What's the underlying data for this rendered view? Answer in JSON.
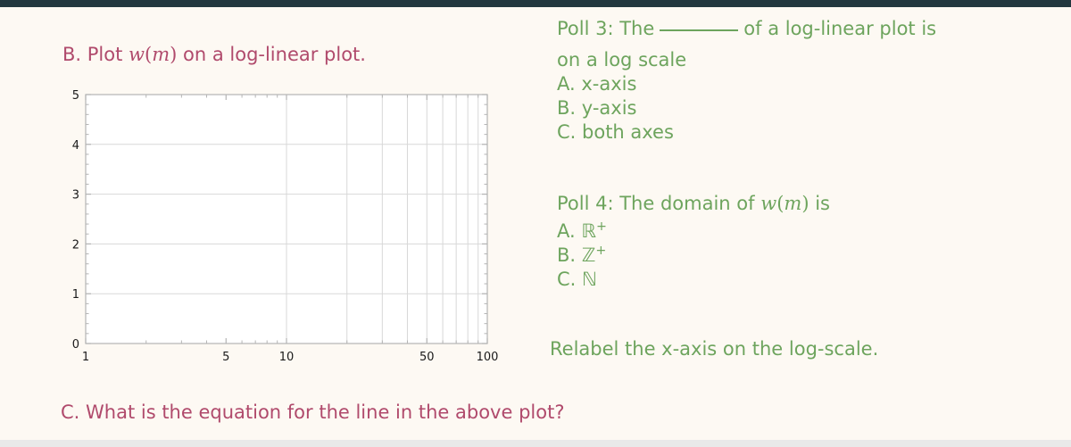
{
  "slide": {
    "background_color": "#fdf9f3",
    "top_bar_color": "#23383f",
    "bottom_bar_color": "#e9e9e9",
    "question_color": "#b04a6c",
    "poll_color": "#6da45d"
  },
  "prompts": {
    "b_prefix": "B. Plot ",
    "b_func_w": "w",
    "b_func_open": "(",
    "b_func_m": "m",
    "b_func_close": ")",
    "b_suffix": " on a log-linear plot.",
    "c_text": "C. What is the equation for the line in the above plot?"
  },
  "poll3": {
    "lead": "Poll 3:  The",
    "after_blank": "of a log-linear plot is",
    "line2": "on a log scale",
    "options": [
      "A. x-axis",
      "B. y-axis",
      "C. both axes"
    ]
  },
  "poll4": {
    "lead": "Poll 4:  The domain of ",
    "func_w": "w",
    "func_open": "(",
    "func_m": "m",
    "func_close": ")",
    "trail": " is",
    "options": [
      {
        "label": "A. ",
        "set": "ℝ",
        "sup": "+"
      },
      {
        "label": "B. ",
        "set": "ℤ",
        "sup": "+"
      },
      {
        "label": "C. ",
        "set": "ℕ",
        "sup": ""
      }
    ]
  },
  "instruction": {
    "relabel": "Relabel the x-axis on the log-scale."
  },
  "chart_data": {
    "type": "line",
    "title": "",
    "xlabel": "",
    "ylabel": "",
    "xscale": "log",
    "yscale": "linear",
    "xlim": [
      1,
      100
    ],
    "ylim": [
      0,
      5
    ],
    "grid": true,
    "legend": "none",
    "series": [],
    "xticks": [
      {
        "value": 1,
        "label": "1"
      },
      {
        "value": 5,
        "label": "5"
      },
      {
        "value": 10,
        "label": "10"
      },
      {
        "value": 50,
        "label": "50"
      },
      {
        "value": 100,
        "label": "100"
      }
    ],
    "x_minor_ticks": [
      2,
      3,
      4,
      6,
      7,
      8,
      9,
      20,
      30,
      40,
      60,
      70,
      80,
      90
    ],
    "x_gridlines": [
      10,
      20,
      30,
      40,
      50,
      60,
      70,
      80,
      90,
      100
    ],
    "yticks": [
      {
        "value": 0,
        "label": "0"
      },
      {
        "value": 1,
        "label": "1"
      },
      {
        "value": 2,
        "label": "2"
      },
      {
        "value": 3,
        "label": "3"
      },
      {
        "value": 4,
        "label": "4"
      },
      {
        "value": 5,
        "label": "5"
      }
    ],
    "y_minor_step": 0.2,
    "y_gridlines": [
      1,
      2,
      3,
      4
    ],
    "frame_color": "#b4b4b4",
    "grid_color": "#d8d8d8",
    "plot_bg": "#ffffff",
    "tick_label_color": "#1a1a1a"
  }
}
